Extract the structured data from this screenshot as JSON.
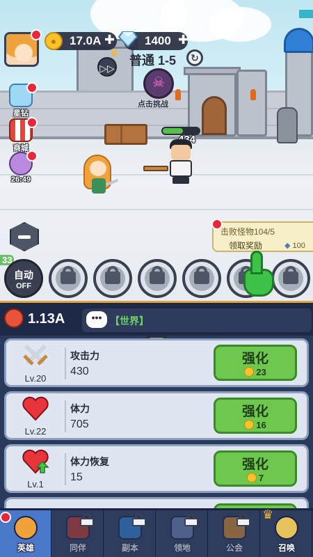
{
  "hud": {
    "gold": "17.0A",
    "gems": "1400",
    "stage": "普通 1-5",
    "boss_challenge": "点击挑战",
    "side_items": [
      {
        "label": "星钻"
      },
      {
        "label": "商城"
      },
      {
        "label": "26:49"
      }
    ]
  },
  "battle": {
    "enemy_hp_fraction": 0.55,
    "damage": "434",
    "quest": {
      "title": "击败怪物104/5",
      "action": "领取奖励",
      "reward": "100"
    },
    "auto": {
      "label": "自动",
      "state": "OFF"
    },
    "side_number": "33",
    "skill_slots_locked": 6
  },
  "info": {
    "power": "1.13A",
    "chat_channel": "【世界】"
  },
  "upgrades": [
    {
      "icon": "swords-icon",
      "level": "Lv.20",
      "name": "攻击力",
      "value": "430",
      "button": "强化",
      "cost": "23"
    },
    {
      "icon": "heart-icon",
      "level": "Lv.22",
      "name": "体力",
      "value": "705",
      "button": "强化",
      "cost": "16"
    },
    {
      "icon": "heart-regen-icon",
      "level": "Lv.1",
      "name": "体力恢复",
      "value": "15",
      "button": "强化",
      "cost": "7"
    }
  ],
  "tabs": [
    {
      "label": "英雄",
      "active": true,
      "locked": false
    },
    {
      "label": "同伴",
      "active": false,
      "locked": true
    },
    {
      "label": "副本",
      "active": false,
      "locked": true
    },
    {
      "label": "领地",
      "active": false,
      "locked": true
    },
    {
      "label": "公会",
      "active": false,
      "locked": true
    },
    {
      "label": "召唤",
      "active": false,
      "locked": false
    }
  ]
}
